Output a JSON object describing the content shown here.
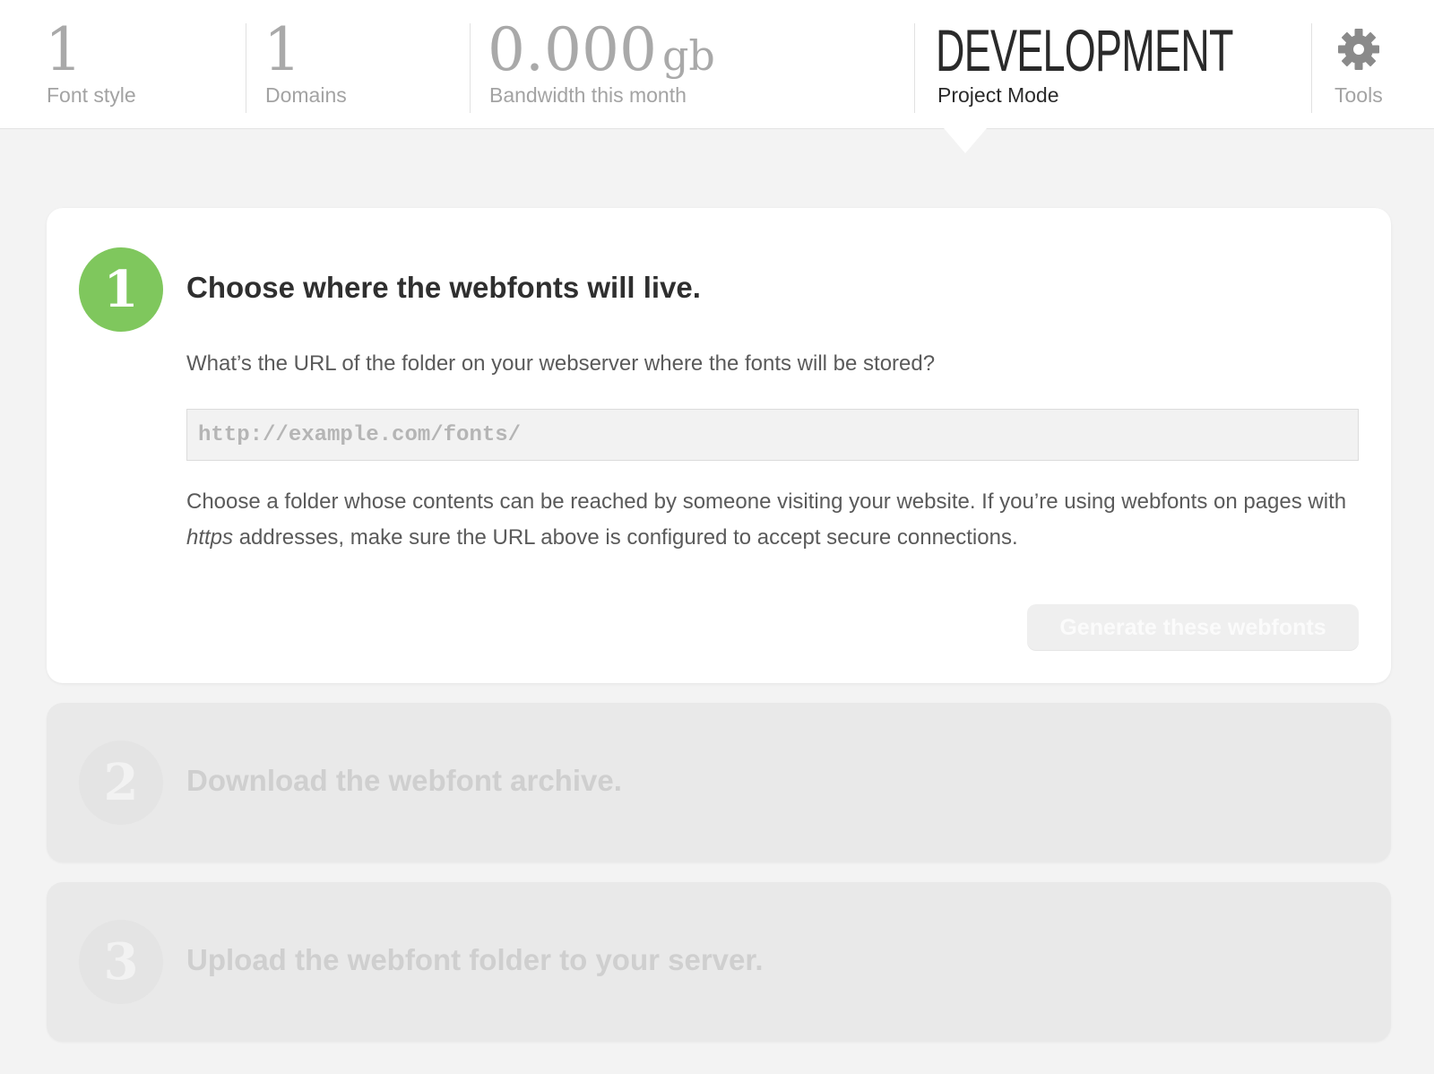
{
  "header": {
    "stats": [
      {
        "value": "1",
        "label": "Font style"
      },
      {
        "value": "1",
        "label": "Domains"
      },
      {
        "value": "0.000",
        "unit": "gb",
        "label": "Bandwidth this month"
      }
    ],
    "mode": {
      "value": "DEVELOPMENT",
      "label": "Project Mode"
    },
    "tools": {
      "label": "Tools",
      "icon": "gear-icon"
    }
  },
  "steps": [
    {
      "number": "1",
      "title": "Choose where the webfonts will live.",
      "question": "What’s the URL of the folder on your webserver where the fonts will be stored?",
      "url_input": {
        "placeholder": "http://example.com/fonts/",
        "value": ""
      },
      "help_part1": "Choose a folder whose contents can be reached by someone visiting your website. If you’re using webfonts on pages with ",
      "help_emph": "https",
      "help_part2": " addresses, make sure the URL above is configured to accept secure connections.",
      "button_label": "Generate these webfonts",
      "state": "active"
    },
    {
      "number": "2",
      "title": "Download the webfont archive.",
      "state": "disabled"
    },
    {
      "number": "3",
      "title": "Upload the webfont folder to your server.",
      "state": "disabled"
    }
  ],
  "colors": {
    "accent": "#7fc75d",
    "background": "#f3f3f3"
  }
}
